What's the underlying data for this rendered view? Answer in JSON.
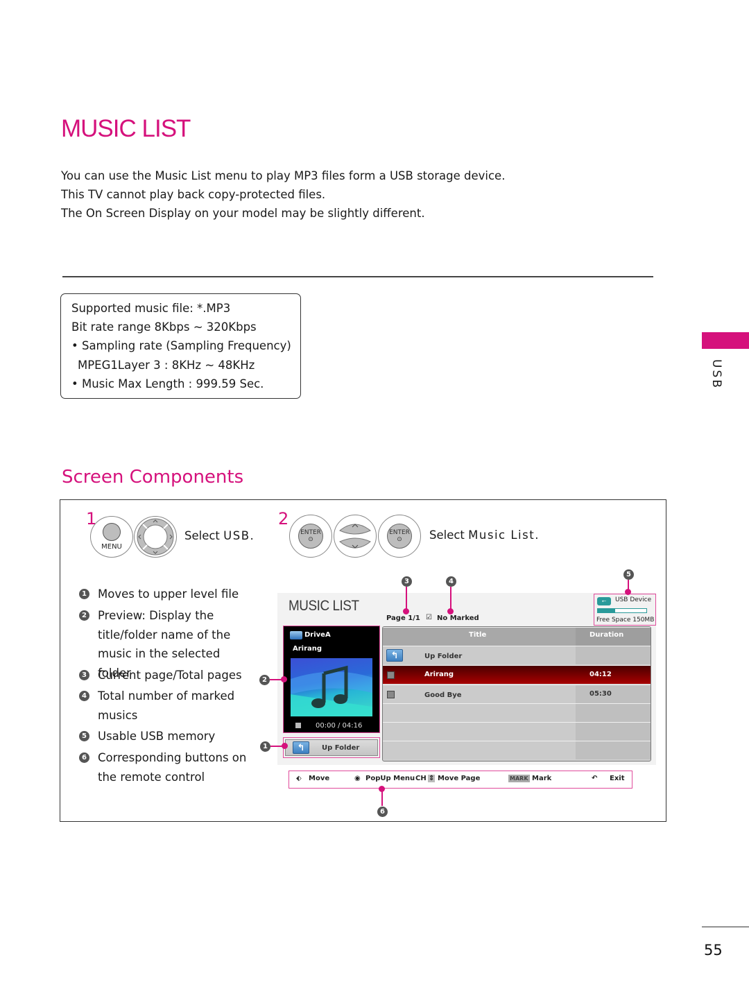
{
  "page": {
    "title": "MUSIC LIST",
    "intro": [
      "You can use the Music List menu to play MP3 files form a USB storage device.",
      "This TV cannot play back copy-protected files.",
      "The On Screen Display on your model may be slightly different."
    ],
    "side_tab_label": "USB",
    "page_number": "55",
    "accent_color": "#d5117c"
  },
  "spec_box": {
    "heading": "Supported music file: *.MP3",
    "lines": [
      "Bit rate range 8Kbps ~ 320Kbps",
      "• Sampling rate (Sampling Frequency)",
      "MPEG1Layer 3 : 8KHz ~ 48KHz",
      "• Music Max Length : 999.59 Sec."
    ]
  },
  "screen_components": {
    "title": "Screen Components",
    "steps": [
      {
        "number": "1",
        "text_prefix": "Select ",
        "text_bold": "USB",
        "text_suffix": ".",
        "buttons": [
          "MENU",
          "navigation-pad"
        ]
      },
      {
        "number": "2",
        "text_prefix": "Select ",
        "text_bold": "Music List",
        "text_suffix": ".",
        "buttons": [
          "ENTER",
          "up-down-pad",
          "ENTER"
        ]
      }
    ],
    "remote_labels": {
      "menu": "MENU",
      "enter": "ENTER"
    },
    "legend": [
      {
        "num": "1",
        "text": "Moves to upper level file"
      },
      {
        "num": "2",
        "text": "Preview: Display the title/folder name of the music in the selected folder"
      },
      {
        "num": "3",
        "text": "Current page/Total pages"
      },
      {
        "num": "4",
        "text": "Total number of marked musics"
      },
      {
        "num": "5",
        "text": "Usable USB memory"
      },
      {
        "num": "6",
        "text": "Corresponding buttons on the remote control"
      }
    ]
  },
  "osd": {
    "title": "MUSIC LIST",
    "page_info": "Page 1/1",
    "marked_info": "No Marked",
    "usb": {
      "label": "USB Device",
      "free_space": "Free Space 150MB",
      "usage_fraction": 0.35
    },
    "preview": {
      "drive": "DriveA",
      "track": "Arirang",
      "time": "00:00 / 04:16"
    },
    "up_folder_button": "Up Folder",
    "table": {
      "columns": [
        "Title",
        "Duration"
      ],
      "rows": [
        {
          "type": "folder",
          "title": "Up Folder",
          "duration": ""
        },
        {
          "type": "track",
          "title": "Arirang",
          "duration": "04:12",
          "selected": true
        },
        {
          "type": "track",
          "title": "Good Bye",
          "duration": "05:30",
          "selected": false
        }
      ]
    },
    "button_bar": [
      {
        "icon": "move-arrows-icon",
        "label": "Move"
      },
      {
        "icon": "enter-dot-icon",
        "label": "PopUp Menu"
      },
      {
        "key": "CH",
        "icon": "ch-updown-icon",
        "label": "Move Page"
      },
      {
        "key": "MARK",
        "label": "Mark"
      },
      {
        "icon": "return-icon",
        "label": "Exit"
      }
    ]
  }
}
